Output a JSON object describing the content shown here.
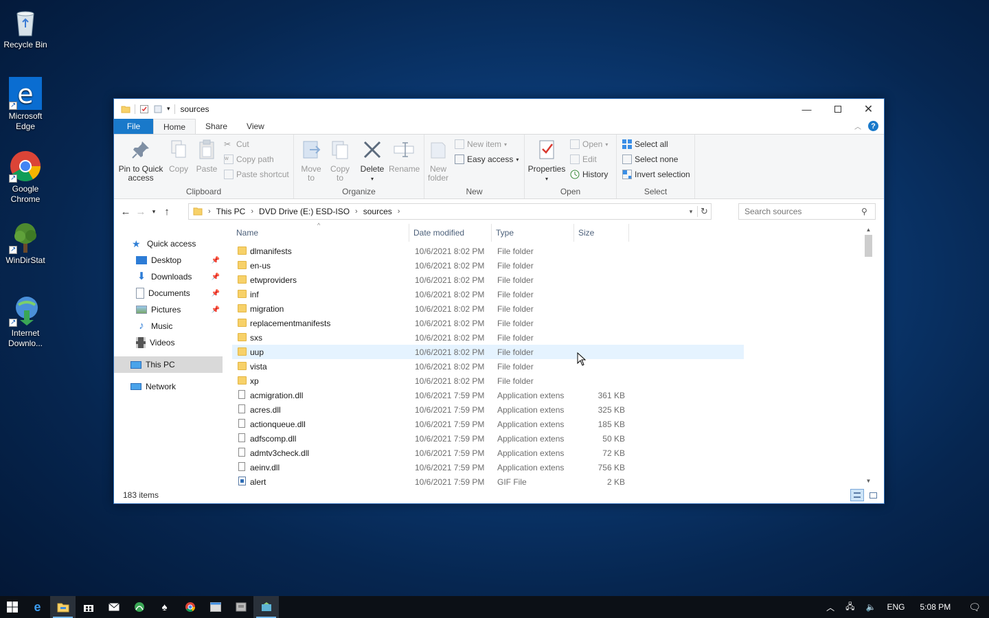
{
  "desktop": {
    "icons": [
      {
        "label": "Recycle Bin"
      },
      {
        "label": "Microsoft Edge"
      },
      {
        "label": "Google Chrome"
      },
      {
        "label": "WinDirStat"
      },
      {
        "label": "Internet Downlo..."
      }
    ]
  },
  "window": {
    "title": "sources",
    "tabs": {
      "file": "File",
      "home": "Home",
      "share": "Share",
      "view": "View"
    },
    "ribbon": {
      "clipboard": {
        "label": "Clipboard",
        "pin": "Pin to Quick access",
        "copy": "Copy",
        "paste": "Paste",
        "cut": "Cut",
        "copy_path": "Copy path",
        "paste_shortcut": "Paste shortcut"
      },
      "organize": {
        "label": "Organize",
        "move_to": "Move to",
        "copy_to": "Copy to",
        "delete": "Delete",
        "rename": "Rename"
      },
      "new": {
        "label": "New",
        "new_folder": "New folder",
        "new_item": "New item",
        "easy_access": "Easy access"
      },
      "open": {
        "label": "Open",
        "properties": "Properties",
        "open": "Open",
        "edit": "Edit",
        "history": "History"
      },
      "select": {
        "label": "Select",
        "select_all": "Select all",
        "select_none": "Select none",
        "invert": "Invert selection"
      }
    },
    "address": {
      "crumbs": [
        "This PC",
        "DVD Drive (E:) ESD-ISO",
        "sources"
      ],
      "search_placeholder": "Search sources"
    },
    "nav": {
      "quick_access": "Quick access",
      "desktop": "Desktop",
      "downloads": "Downloads",
      "documents": "Documents",
      "pictures": "Pictures",
      "music": "Music",
      "videos": "Videos",
      "this_pc": "This PC",
      "network": "Network"
    },
    "columns": {
      "name": "Name",
      "date": "Date modified",
      "type": "Type",
      "size": "Size"
    },
    "files": [
      {
        "name": "dlmanifests",
        "date": "10/6/2021 8:02 PM",
        "type": "File folder",
        "size": "",
        "kind": "folder"
      },
      {
        "name": "en-us",
        "date": "10/6/2021 8:02 PM",
        "type": "File folder",
        "size": "",
        "kind": "folder"
      },
      {
        "name": "etwproviders",
        "date": "10/6/2021 8:02 PM",
        "type": "File folder",
        "size": "",
        "kind": "folder"
      },
      {
        "name": "inf",
        "date": "10/6/2021 8:02 PM",
        "type": "File folder",
        "size": "",
        "kind": "folder"
      },
      {
        "name": "migration",
        "date": "10/6/2021 8:02 PM",
        "type": "File folder",
        "size": "",
        "kind": "folder"
      },
      {
        "name": "replacementmanifests",
        "date": "10/6/2021 8:02 PM",
        "type": "File folder",
        "size": "",
        "kind": "folder"
      },
      {
        "name": "sxs",
        "date": "10/6/2021 8:02 PM",
        "type": "File folder",
        "size": "",
        "kind": "folder"
      },
      {
        "name": "uup",
        "date": "10/6/2021 8:02 PM",
        "type": "File folder",
        "size": "",
        "kind": "folder"
      },
      {
        "name": "vista",
        "date": "10/6/2021 8:02 PM",
        "type": "File folder",
        "size": "",
        "kind": "folder"
      },
      {
        "name": "xp",
        "date": "10/6/2021 8:02 PM",
        "type": "File folder",
        "size": "",
        "kind": "folder"
      },
      {
        "name": "acmigration.dll",
        "date": "10/6/2021 7:59 PM",
        "type": "Application extens",
        "size": "361 KB",
        "kind": "file"
      },
      {
        "name": "acres.dll",
        "date": "10/6/2021 7:59 PM",
        "type": "Application extens",
        "size": "325 KB",
        "kind": "file"
      },
      {
        "name": "actionqueue.dll",
        "date": "10/6/2021 7:59 PM",
        "type": "Application extens",
        "size": "185 KB",
        "kind": "file"
      },
      {
        "name": "adfscomp.dll",
        "date": "10/6/2021 7:59 PM",
        "type": "Application extens",
        "size": "50 KB",
        "kind": "file"
      },
      {
        "name": "admtv3check.dll",
        "date": "10/6/2021 7:59 PM",
        "type": "Application extens",
        "size": "72 KB",
        "kind": "file"
      },
      {
        "name": "aeinv.dll",
        "date": "10/6/2021 7:59 PM",
        "type": "Application extens",
        "size": "756 KB",
        "kind": "file"
      },
      {
        "name": "alert",
        "date": "10/6/2021 7:59 PM",
        "type": "GIF File",
        "size": "2 KB",
        "kind": "gif"
      }
    ],
    "status": {
      "count": "183 items"
    }
  },
  "taskbar": {
    "lang": "ENG",
    "time": "5:08 PM"
  },
  "colors": {
    "accent": "#1979ca",
    "hover_row": "#e5f3ff",
    "folder": "#f7d169"
  }
}
